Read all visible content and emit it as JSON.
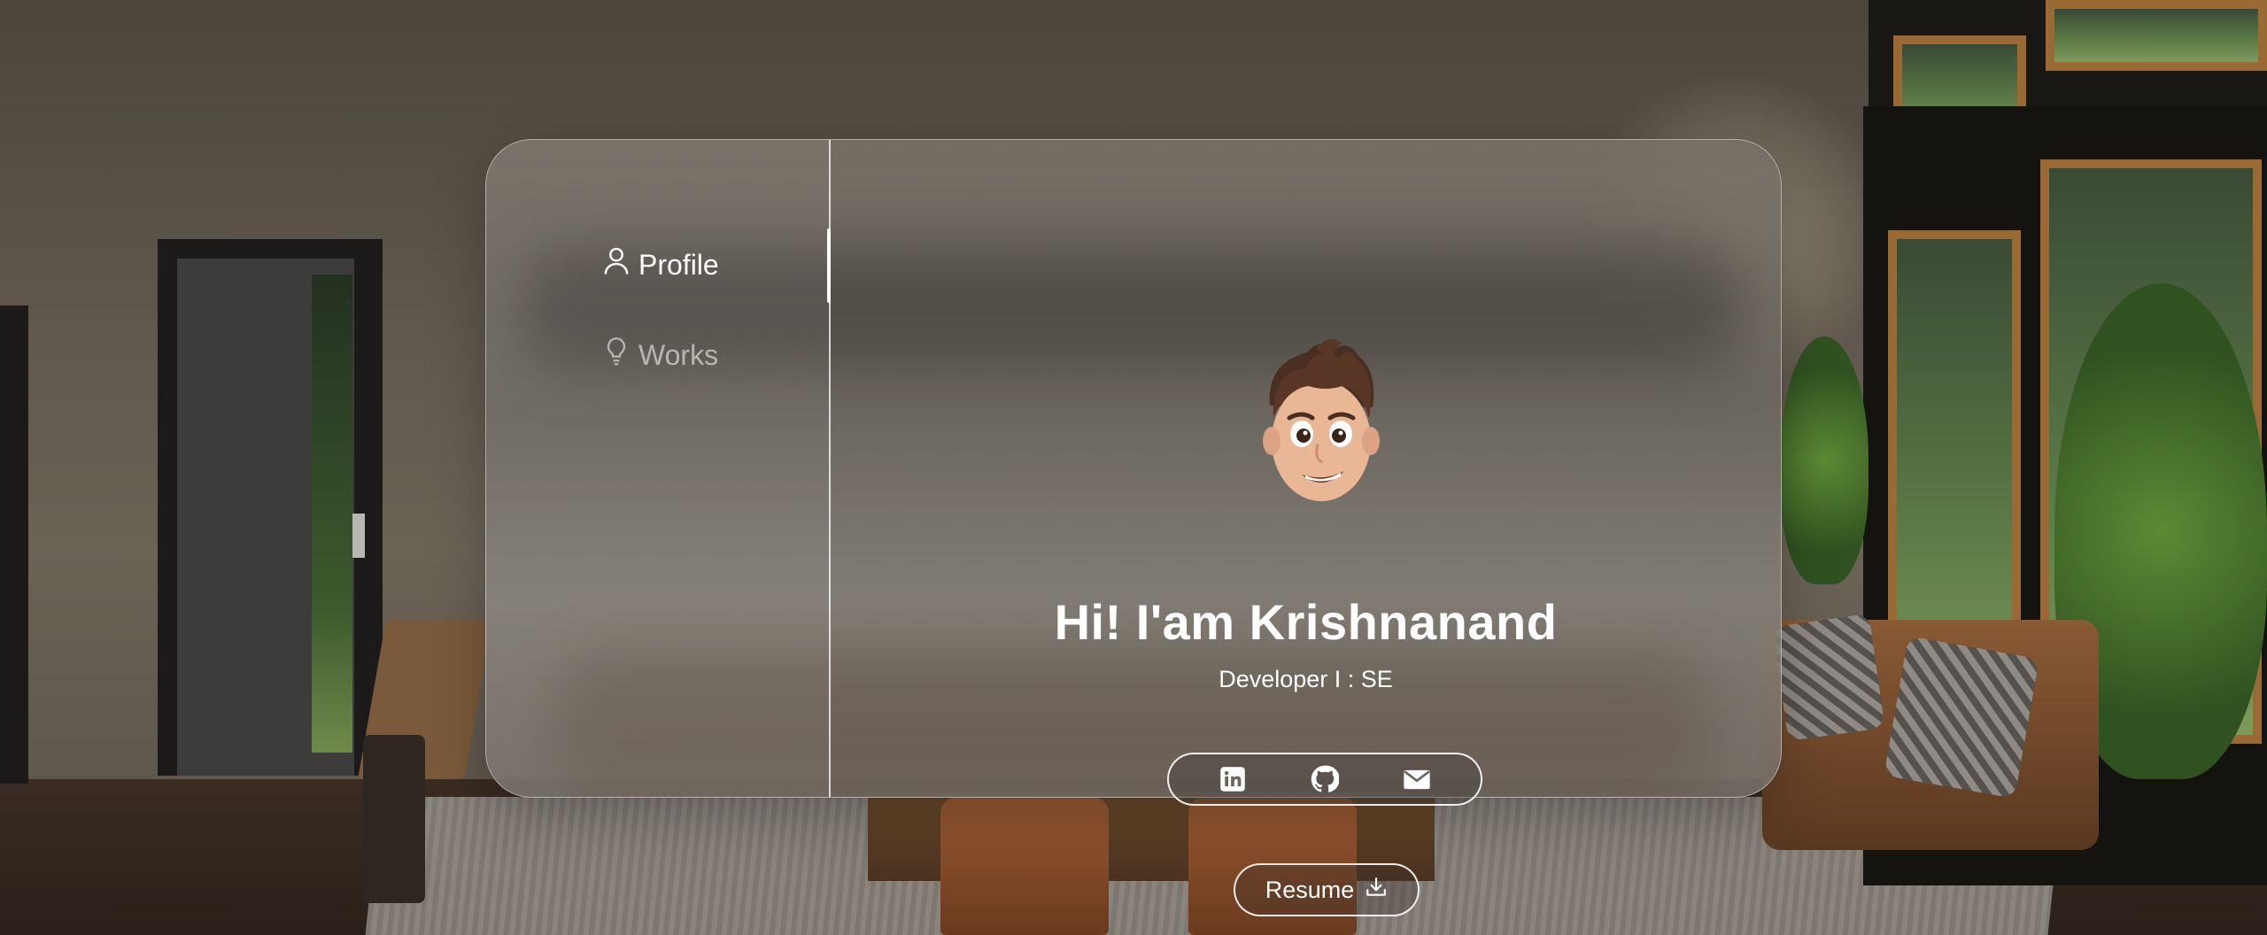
{
  "nav": {
    "items": [
      {
        "label": "Profile",
        "icon": "person-icon",
        "active": true
      },
      {
        "label": "Works",
        "icon": "lightbulb-icon",
        "active": false
      }
    ]
  },
  "profile": {
    "greeting": "Hi! I'am Krishnanand",
    "role": "Developer I : SE",
    "avatar": "memoji-avatar"
  },
  "social": {
    "links": [
      {
        "icon": "linkedin-icon"
      },
      {
        "icon": "github-icon"
      },
      {
        "icon": "mail-icon"
      }
    ]
  },
  "resume": {
    "label": "Resume",
    "icon": "download-icon"
  },
  "colors": {
    "text": "#ffffff",
    "inactive_text": "#b8b4ad",
    "glass_border": "#d9d6d0"
  }
}
